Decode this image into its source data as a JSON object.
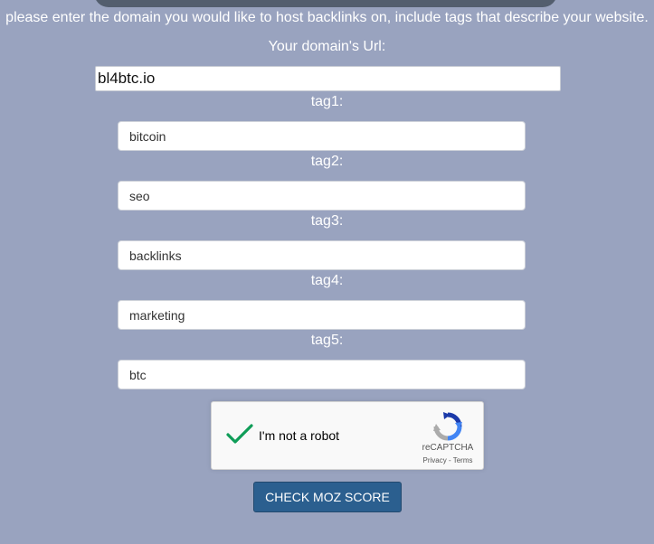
{
  "instructions": "please enter the domain you would like to host backlinks on, include tags that describe your website.",
  "domain": {
    "label": "Your domain's Url:",
    "value": "bl4btc.io"
  },
  "tags": [
    {
      "label": "tag1:",
      "value": "bitcoin"
    },
    {
      "label": "tag2:",
      "value": "seo"
    },
    {
      "label": "tag3:",
      "value": "backlinks"
    },
    {
      "label": "tag4:",
      "value": "marketing"
    },
    {
      "label": "tag5:",
      "value": "btc"
    }
  ],
  "captcha": {
    "label": "I'm not a robot",
    "brand": "reCAPTCHA",
    "links": "Privacy - Terms",
    "checked": true,
    "check_color": "#0f9d58"
  },
  "submit_label": "CHECK MOZ SCORE",
  "colors": {
    "background": "#99a3bf",
    "button": "#2b5f8f"
  }
}
